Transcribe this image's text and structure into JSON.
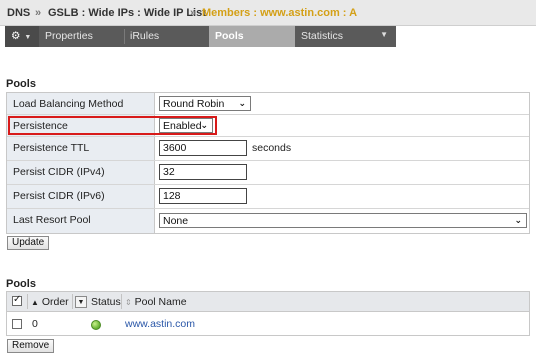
{
  "breadcrumb": {
    "items": [
      "DNS",
      "GSLB : Wide IPs : Wide IP List"
    ],
    "separator": "»",
    "current": "Members : www.astin.com : A",
    "current_color": "#d4a017"
  },
  "tabs": [
    {
      "label": "Properties",
      "active": false
    },
    {
      "label": "iRules",
      "active": false
    },
    {
      "label": "Pools",
      "active": true
    },
    {
      "label": "Statistics",
      "active": false,
      "has_dropdown": true
    }
  ],
  "tab_icons": {
    "gear": "gear-icon",
    "dropdown": "chevron-down-icon"
  },
  "pools_section": {
    "title": "Pools",
    "fields": {
      "load_balancing_method": {
        "label": "Load Balancing Method",
        "value": "Round Robin"
      },
      "persistence": {
        "label": "Persistence",
        "value": "Enabled"
      },
      "persistence_ttl": {
        "label": "Persistence TTL",
        "value": "3600",
        "unit": "seconds"
      },
      "persist_cidr_ipv4": {
        "label": "Persist CIDR (IPv4)",
        "value": "32"
      },
      "persist_cidr_ipv6": {
        "label": "Persist CIDR (IPv6)",
        "value": "128"
      },
      "last_resort_pool": {
        "label": "Last Resort Pool",
        "value": "None"
      }
    },
    "update_label": "Update",
    "highlight_color": "#d81a1a"
  },
  "pools_list": {
    "title": "Pools",
    "columns": {
      "order": "Order",
      "status": "Status",
      "pool_name": "Pool Name"
    },
    "sort_indicator": "▲",
    "rows": [
      {
        "order": "0",
        "status": "available",
        "status_color": "#6fb83a",
        "pool_name": "www.astin.com"
      }
    ],
    "remove_label": "Remove"
  }
}
